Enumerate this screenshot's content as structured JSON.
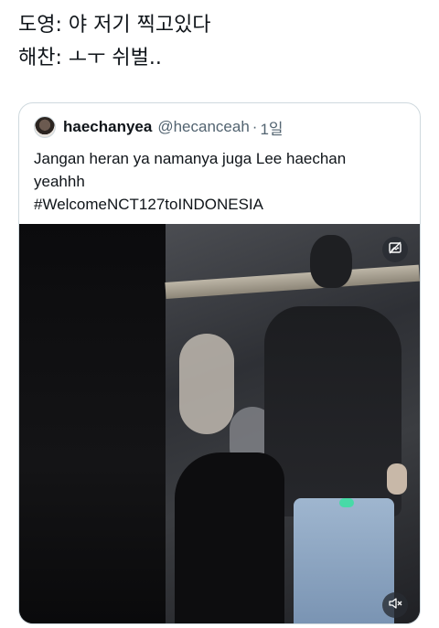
{
  "tweet": {
    "lines": [
      "도영: 야 저기 찍고있다",
      "해찬: ㅗㅜ 쉬벌.."
    ]
  },
  "quote": {
    "display_name": "haechanyea",
    "handle": "@hecanceah",
    "separator": "·",
    "time": "1일",
    "body_lines": [
      "Jangan heran ya namanya juga Lee haechan",
      "yeahhh",
      "#WelcomeNCT127toINDONESIA"
    ]
  },
  "icons": {
    "media_top": "hide-media-icon",
    "media_bottom": "mute-icon"
  },
  "colors": {
    "text_primary": "#0f1419",
    "text_secondary": "#536471",
    "border": "#cfd9de"
  }
}
